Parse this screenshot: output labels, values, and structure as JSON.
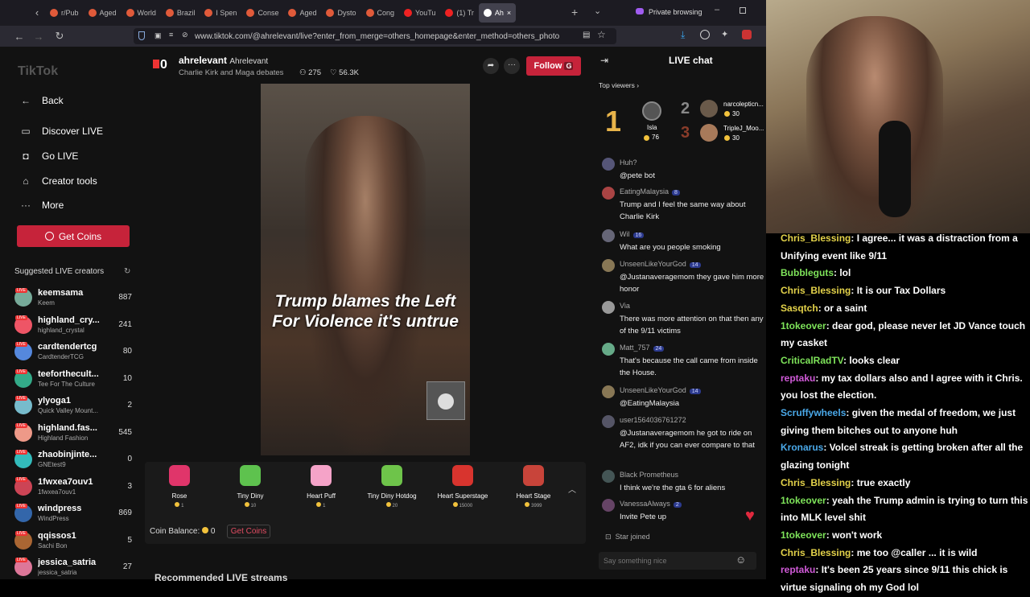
{
  "browser": {
    "tabs": [
      "r/Pub",
      "World",
      "Brazil",
      "I Spen",
      "Conse",
      "Aged",
      "Dysto",
      "Cong",
      "YouTu",
      "(1) Tr",
      "Ah"
    ],
    "first_tab": "Aged",
    "private": "Private browsing",
    "url": "www.tiktok.com/@ahrelevant/live?enter_from_merge=others_homepage&enter_method=others_photo"
  },
  "sidebar": {
    "logo": "TikTok",
    "back": "Back",
    "nav": [
      "Discover LIVE",
      "Go LIVE",
      "Creator tools",
      "More"
    ],
    "get_coins": "Get Coins",
    "suggested_title": "Suggested LIVE creators",
    "creators": [
      {
        "name": "keemsama",
        "sub": "Keem",
        "count": "887"
      },
      {
        "name": "highland_cry...",
        "sub": "highland_crystal",
        "count": "241"
      },
      {
        "name": "cardtendertcg",
        "sub": "CardtenderTCG",
        "count": "80"
      },
      {
        "name": "teeforthecult...",
        "sub": "Tee For The Culture",
        "count": "10"
      },
      {
        "name": "ylyoga1",
        "sub": "Quick Valley Mount...",
        "count": "2"
      },
      {
        "name": "highland.fas...",
        "sub": "Highland Fashion",
        "count": "545"
      },
      {
        "name": "zhaobinjinte...",
        "sub": "GNEtest9",
        "count": "0"
      },
      {
        "name": "1fwxea7ouv1",
        "sub": "1fwxea7ouv1",
        "count": "3"
      },
      {
        "name": "windpress",
        "sub": "WindPress",
        "count": "869"
      },
      {
        "name": "qqissos1",
        "sub": "Sachi Bon",
        "count": "5"
      },
      {
        "name": "jessica_satria",
        "sub": "jessica_satria",
        "count": "27"
      }
    ]
  },
  "header": {
    "zero": "0",
    "username": "ahrelevant",
    "display": "Ahrelevant",
    "topic": "Charlie Kirk and Maga debates",
    "viewers": "275",
    "likes": "56.3K",
    "follow": "Follow"
  },
  "video": {
    "caption_line1": "Trump blames the Left",
    "caption_line2": "For Violence it's untrue"
  },
  "gifts": [
    {
      "name": "Rose",
      "price": "1",
      "color": "#e0356a"
    },
    {
      "name": "Tiny Diny",
      "price": "10",
      "color": "#5ec24e"
    },
    {
      "name": "Heart Puff",
      "price": "1",
      "color": "#f5a3c8"
    },
    {
      "name": "Tiny Diny Hotdog",
      "price": "20",
      "color": "#6ec44a"
    },
    {
      "name": "Heart Superstage",
      "price": "15000",
      "color": "#d8342e"
    },
    {
      "name": "Heart Stage",
      "price": "3999",
      "color": "#c8443a"
    }
  ],
  "coin_balance": {
    "label": "Coin Balance:",
    "value": "0",
    "get": "Get Coins"
  },
  "recommended": "Recommended LIVE streams",
  "chat": {
    "title": "LIVE chat",
    "top_viewers": "Top viewers",
    "ranks": [
      {
        "rank": "1",
        "name": "Isla",
        "score": "76"
      },
      {
        "rank": "2",
        "name": "narcolepticn...",
        "score": "30"
      },
      {
        "rank": "3",
        "name": "TripleJ_Moo...",
        "score": "30"
      }
    ],
    "messages": [
      {
        "user": "Huh?",
        "badge": "",
        "text": "@pete bot"
      },
      {
        "user": "EatingMalaysia",
        "badge": "8",
        "text": "Trump and I feel the same way about Charlie Kirk"
      },
      {
        "user": "Wil",
        "badge": "16",
        "text": "What are you people smoking"
      },
      {
        "user": "UnseenLikeYourGod",
        "badge": "14",
        "text": "@Justanaveragemom they gave him more honor"
      },
      {
        "user": "Via",
        "badge": "",
        "text": "There was more attention on that then any of the 9/11 victims"
      },
      {
        "user": "Matt_757",
        "badge": "24",
        "text": "That's because the call came from inside the House."
      },
      {
        "user": "UnseenLikeYourGod",
        "badge": "14",
        "text": "@EatingMalaysia"
      },
      {
        "user": "user1564036761272",
        "badge": "",
        "text": "@Justanaveragemom he got to ride on AF2, idk if you can ever compare to that"
      },
      {
        "user": "Black Prometheus",
        "badge": "",
        "text": "I think we're the gta 6 for aliens"
      },
      {
        "user": "VanessaAlways",
        "badge": "2",
        "text": "Invite Pete up"
      }
    ],
    "joined": "Star joined",
    "input_placeholder": "Say something nice"
  },
  "overlay": [
    {
      "user": "Chris_Blessing",
      "color": "#e3d24a",
      "text": ": I agree... it was a distraction from a Unifying event like 9/11"
    },
    {
      "user": "Bubbleguts",
      "color": "#7ee35a",
      "text": ": lol"
    },
    {
      "user": "Chris_Blessing",
      "color": "#e3d24a",
      "text": ": It is our Tax Dollars"
    },
    {
      "user": "Sasqtch",
      "color": "#e3d24a",
      "text": ": or a saint"
    },
    {
      "user": "1tokeover",
      "color": "#7ee35a",
      "text": ": dear god, please never let JD Vance touch my casket"
    },
    {
      "user": "CriticalRadTV",
      "color": "#7ee35a",
      "text": ": looks clear"
    },
    {
      "user": "reptaku",
      "color": "#d05ad8",
      "text": ": my tax dollars also and I agree with it Chris. you lost the election."
    },
    {
      "user": "Scruffywheels",
      "color": "#4aa8e8",
      "text": ": given the medal of freedom, we just giving them bitches out to anyone huh"
    },
    {
      "user": "Kronarus",
      "color": "#4aa8e8",
      "text": ": Volcel streak is getting broken after all the glazing tonight"
    },
    {
      "user": "Chris_Blessing",
      "color": "#e3d24a",
      "text": ": true exactly"
    },
    {
      "user": "1tokeover",
      "color": "#7ee35a",
      "text": ": yeah the Trump admin is trying to turn this into MLK level shit"
    },
    {
      "user": "1tokeover",
      "color": "#7ee35a",
      "text": ": won't work"
    },
    {
      "user": "Chris_Blessing",
      "color": "#e3d24a",
      "text": ": me too @caller ... it is wild"
    },
    {
      "user": "reptaku",
      "color": "#d05ad8",
      "text": ": It's been 25 years since 9/11 this chick is virtue signaling oh my God lol"
    }
  ]
}
